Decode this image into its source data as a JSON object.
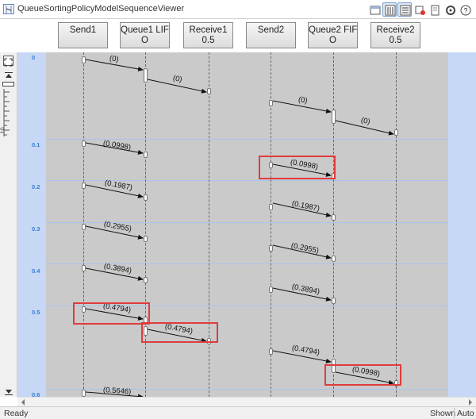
{
  "window": {
    "title": "QueueSortingPolicyModelSequenceViewer"
  },
  "toolbar": {
    "buttons": [
      {
        "name": "panel-icon"
      },
      {
        "name": "lifeline-icon",
        "active": true
      },
      {
        "name": "properties-icon",
        "active": true
      },
      {
        "name": "filter-icon"
      },
      {
        "name": "reference-icon"
      },
      {
        "name": "settings-icon"
      },
      {
        "name": "help-icon"
      }
    ]
  },
  "lifelines": [
    {
      "line1": "Send1",
      "line2": ""
    },
    {
      "line1": "Queue1 LIF",
      "line2": "O"
    },
    {
      "line1": "Receive1",
      "line2": "0.5"
    },
    {
      "line1": "Send2",
      "line2": ""
    },
    {
      "line1": "Queue2 FIF",
      "line2": "O"
    },
    {
      "line1": "Receive2",
      "line2": "0.5"
    }
  ],
  "left_bar": {
    "zoom_value": "10"
  },
  "time_labels": [
    "0",
    "0.1",
    "0.2",
    "0.3",
    "0.4",
    "0.5",
    "0.6"
  ],
  "messages": [
    {
      "label": "(0)",
      "highlighted": false
    },
    {
      "label": "(0)",
      "highlighted": false
    },
    {
      "label": "(0)",
      "highlighted": false
    },
    {
      "label": "(0)",
      "highlighted": false
    },
    {
      "label": "(0.0998)",
      "highlighted": false
    },
    {
      "label": "(0.0998)",
      "highlighted": true
    },
    {
      "label": "(0.1987)",
      "highlighted": false
    },
    {
      "label": "(0.1987)",
      "highlighted": false
    },
    {
      "label": "(0.2955)",
      "highlighted": false
    },
    {
      "label": "(0.2955)",
      "highlighted": false
    },
    {
      "label": "(0.3894)",
      "highlighted": false
    },
    {
      "label": "(0.3894)",
      "highlighted": false
    },
    {
      "label": "(0.4794)",
      "highlighted": true
    },
    {
      "label": "(0.4794)",
      "highlighted": true
    },
    {
      "label": "(0.4794)",
      "highlighted": false
    },
    {
      "label": "(0.0998)",
      "highlighted": true
    },
    {
      "label": "(0.5646)",
      "highlighted": false
    }
  ],
  "status": {
    "left": "Ready",
    "shown": "Shown",
    "auto": "Auto"
  },
  "colors": {
    "highlight": "#e03c3c",
    "time_accent": "#3a7bd5",
    "panel_blue": "#c6d8f5"
  }
}
